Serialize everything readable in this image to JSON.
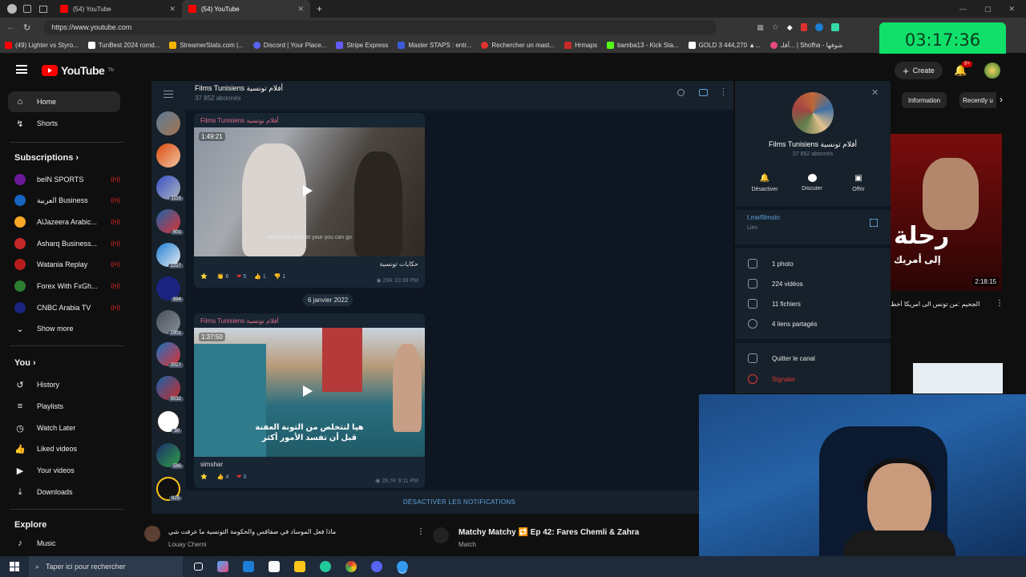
{
  "browser": {
    "tabs": [
      {
        "label": "(54) YouTube"
      },
      {
        "label": "(54) YouTube"
      }
    ],
    "url": "https://www.youtube.com",
    "bookmarks": [
      {
        "label": "(49) Lighter vs Styro...",
        "color": "#ff0000"
      },
      {
        "label": "TunBest 2024 romd...",
        "color": "#ffffff"
      },
      {
        "label": "StreamerStats.com |...",
        "color": "#f4b400"
      },
      {
        "label": "Discord | Your Place...",
        "color": "#5865f2"
      },
      {
        "label": "Stripe Express",
        "color": "#635bff"
      },
      {
        "label": "Master STAPS : entr...",
        "color": "#3b5bdb"
      },
      {
        "label": "Rechercher un mast...",
        "color": "#e03131"
      },
      {
        "label": "Hrmaps",
        "color": "#c92a2a"
      },
      {
        "label": "bamba13 - Kick Sta...",
        "color": "#53fc18"
      },
      {
        "label": "GOLD 3 444,270 ▲...",
        "color": "#ffffff"
      },
      {
        "label": "أفلـ... | Shofha - شوفها",
        "color": "#e64980"
      }
    ]
  },
  "timer": "03:17:36",
  "youtube": {
    "logo": "YouTube",
    "logo_sup": "TN",
    "create": "Create",
    "notif_count": "9+",
    "chips": [
      "Information",
      "Recently u"
    ],
    "nav": [
      {
        "label": "Home",
        "icon": "home-icon"
      },
      {
        "label": "Shorts",
        "icon": "shorts-icon"
      }
    ],
    "subscriptions_title": "Subscriptions",
    "subscriptions": [
      {
        "label": "beIN SPORTS",
        "color": "#6a1b9a"
      },
      {
        "label": "العربية Business",
        "color": "#1565c0"
      },
      {
        "label": "AlJazeera Arabic...",
        "color": "#f9a825"
      },
      {
        "label": "Asharq Business...",
        "color": "#c62828"
      },
      {
        "label": "Watania Replay",
        "color": "#b71c1c"
      },
      {
        "label": "Forex With FxGh...",
        "color": "#2e7d32"
      },
      {
        "label": "CNBC Arabia TV",
        "color": "#1a237e"
      }
    ],
    "show_more": "Show more",
    "you_title": "You",
    "you_items": [
      {
        "label": "History",
        "icon": "history-icon"
      },
      {
        "label": "Playlists",
        "icon": "playlists-icon"
      },
      {
        "label": "Watch Later",
        "icon": "clock-icon"
      },
      {
        "label": "Liked videos",
        "icon": "thumb-up-icon"
      },
      {
        "label": "Your videos",
        "icon": "video-icon"
      },
      {
        "label": "Downloads",
        "icon": "download-icon"
      }
    ],
    "explore_title": "Explore",
    "explore_items": [
      {
        "label": "Music",
        "icon": "music-icon"
      }
    ],
    "right_video": {
      "duration": "2:18:15",
      "title": "الجحيم :من تونس الى امريكا أخط",
      "thumb_text": "رحلة",
      "thumb_sub": "إلى أمريك"
    },
    "bottom_left": {
      "title": "ماذا فعل الموساد في صفاقس والحكومة التونسية ما عرفت شي",
      "channel": "Louay Cherni"
    },
    "bottom_right": {
      "title": "Matchy Matchy 🔁 Ep 42: Fares Chemli & Zahra",
      "channel": "Match"
    }
  },
  "telegram": {
    "channel_name": "Films Tunisiens أفلام تونسية",
    "subscribers": "37 852 abonnés",
    "chat_badges": [
      "",
      "",
      "1115",
      "601",
      "1227",
      "894",
      "1901",
      "2027",
      "5032",
      "30",
      "585",
      "925"
    ],
    "posts": [
      {
        "author": "Films Tunisiens أفلام تونسية",
        "duration": "1:49:21",
        "subtitle": "When you look at your you can go",
        "caption": "حكايات تونسية",
        "reactions": [
          {
            "emoji": "⭐",
            "count": ""
          },
          {
            "emoji": "👏",
            "count": "6"
          },
          {
            "emoji": "❤",
            "count": "5"
          },
          {
            "emoji": "👍",
            "count": "1"
          },
          {
            "emoji": "👎",
            "count": "1"
          }
        ],
        "views": "29K",
        "time": "10:39 PM"
      },
      {
        "author": "Films Tunisiens أفلام تونسية",
        "duration": "1:37:50",
        "subtitle": "هيا لنتخلص من التونة العفنة قبل أن تفسد الأمور أكثر",
        "caption": "simshar",
        "reactions": [
          {
            "emoji": "⭐",
            "count": ""
          },
          {
            "emoji": "👍",
            "count": "4"
          },
          {
            "emoji": "❤",
            "count": "3"
          }
        ],
        "views": "28,7K",
        "time": "9:11 PM"
      }
    ],
    "date_separator": "6 janvier 2022",
    "footer": "DÉSACTIVER LES NOTIFICATIONS",
    "info": {
      "name": "Films Tunisiens أفلام تونسية",
      "subscribers": "37 852 abonnés",
      "actions": [
        {
          "label": "Désactiver",
          "icon": "bell-icon"
        },
        {
          "label": "Discuter",
          "icon": "chat-icon"
        },
        {
          "label": "Offrir",
          "icon": "gift-icon"
        }
      ],
      "link": "t.me/filmstn",
      "link_label": "Lien",
      "stats": [
        {
          "label": "1 photo",
          "icon": "photo-icon"
        },
        {
          "label": "224 vidéos",
          "icon": "video-icon"
        },
        {
          "label": "11 fichiers",
          "icon": "file-icon"
        },
        {
          "label": "4 liens partagés",
          "icon": "link-icon"
        }
      ],
      "leave": "Quitter le canal",
      "report": "Signaler"
    }
  },
  "taskbar": {
    "search_placeholder": "Taper ici pour rechercher"
  }
}
